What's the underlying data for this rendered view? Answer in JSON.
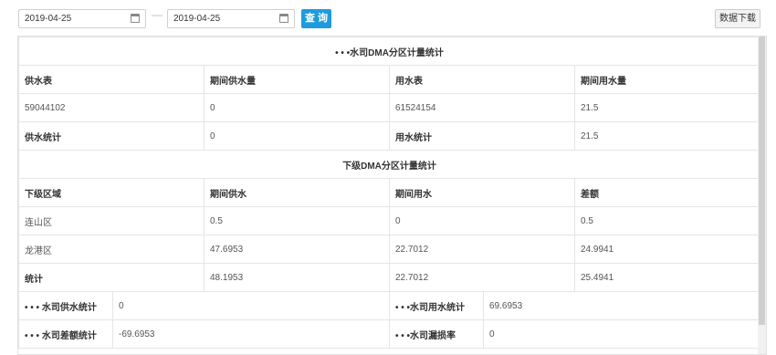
{
  "toolbar": {
    "start_date": "2019-04-25",
    "end_date": "2019-04-25",
    "separator": "—",
    "query_label": "查 询",
    "download_label": "数据下载"
  },
  "section1": {
    "title": "• • •水司DMA分区计量统计",
    "headers": [
      "供水表",
      "期间供水量",
      "用水表",
      "期间用水量"
    ],
    "row": [
      "59044102",
      "0",
      "61524154",
      "21.5"
    ],
    "totals": [
      "供水统计",
      "0",
      "用水统计",
      "21.5"
    ]
  },
  "section2": {
    "title": "下级DMA分区计量统计",
    "headers": [
      "下级区域",
      "期间供水",
      "期间用水",
      "差额"
    ],
    "rows": [
      [
        "连山区",
        "0.5",
        "0",
        "0.5"
      ],
      [
        "龙港区",
        "47.6953",
        "22.7012",
        "24.9941"
      ]
    ],
    "totals": [
      "统计",
      "48.1953",
      "22.7012",
      "25.4941"
    ]
  },
  "summary": {
    "supply_label": "• • •  水司供水统计",
    "supply_value": "0",
    "use_label": "• • •水司用水统计",
    "use_value": "69.6953",
    "diff_label": "• • •  水司差额统计",
    "diff_value": "-69.6953",
    "loss_label": "• • •水司漏损率",
    "loss_value": "0"
  }
}
